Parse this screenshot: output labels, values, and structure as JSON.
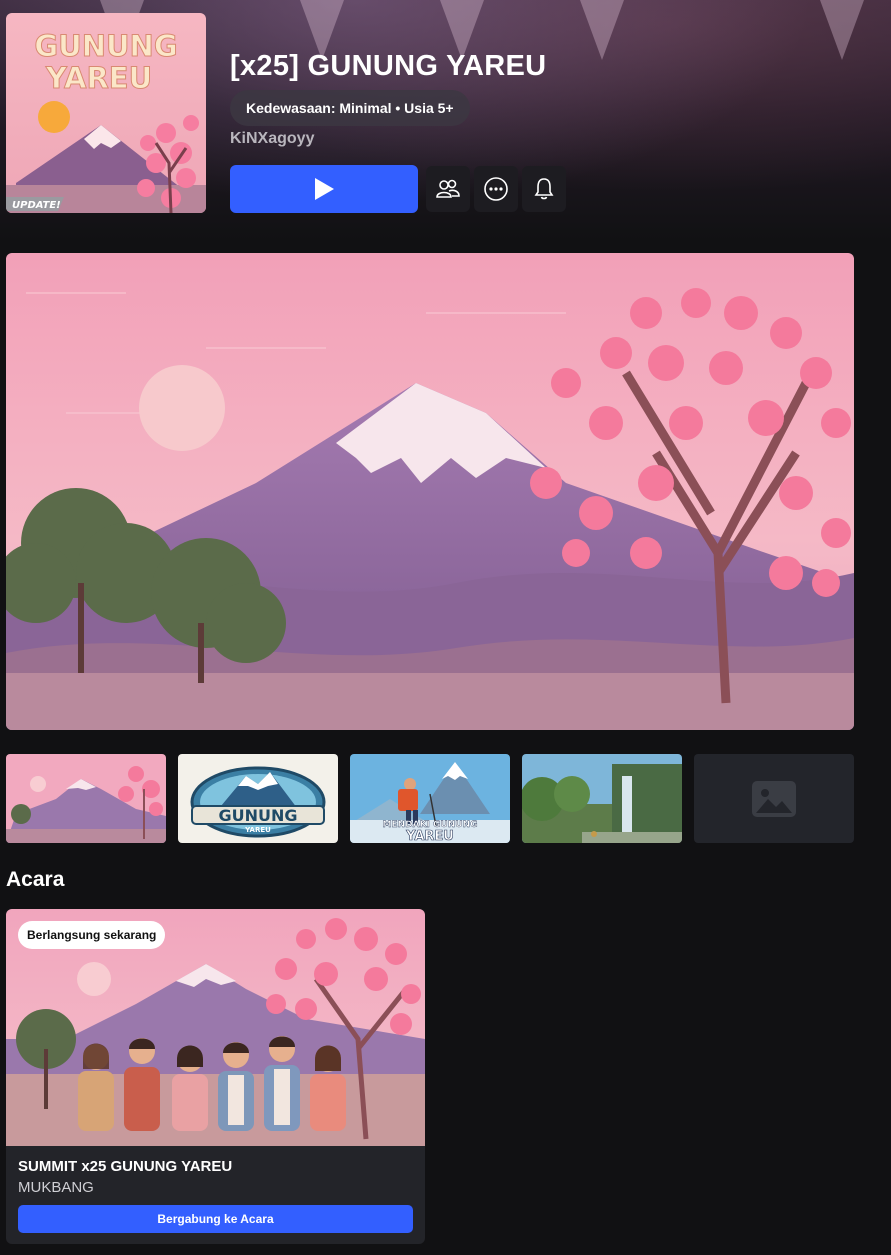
{
  "game": {
    "title": "[x25] GUNUNG YAREU",
    "maturity": "Kedewasaan: Minimal • Usia 5+",
    "creator": "KiNXagoyy",
    "icon_title": "GUNUNG YAREU",
    "icon_badge": "UPDATE!"
  },
  "actions": {
    "play_icon": "play-icon",
    "friends_icon": "friends-icon",
    "more_icon": "more-icon",
    "notify_icon": "bell-icon"
  },
  "gallery": {
    "items": [
      {
        "type": "image",
        "caption": ""
      },
      {
        "type": "image",
        "caption": "GUNUNG YAREU"
      },
      {
        "type": "image",
        "caption": "MENDAKI GUNUNG YAREU"
      },
      {
        "type": "image",
        "caption": ""
      },
      {
        "type": "placeholder",
        "icon": "image-placeholder-icon"
      }
    ]
  },
  "events": {
    "section_title": "Acara",
    "card": {
      "badge": "Berlangsung sekarang",
      "name": "SUMMIT x25 GUNUNG YAREU",
      "subtitle": "MUKBANG",
      "join_label": "Bergabung ke Acara"
    }
  },
  "colors": {
    "background": "#111113",
    "accent": "#335fff",
    "sky_pink": "#f3a9c0",
    "mountain_purple": "#8e6aa6"
  }
}
